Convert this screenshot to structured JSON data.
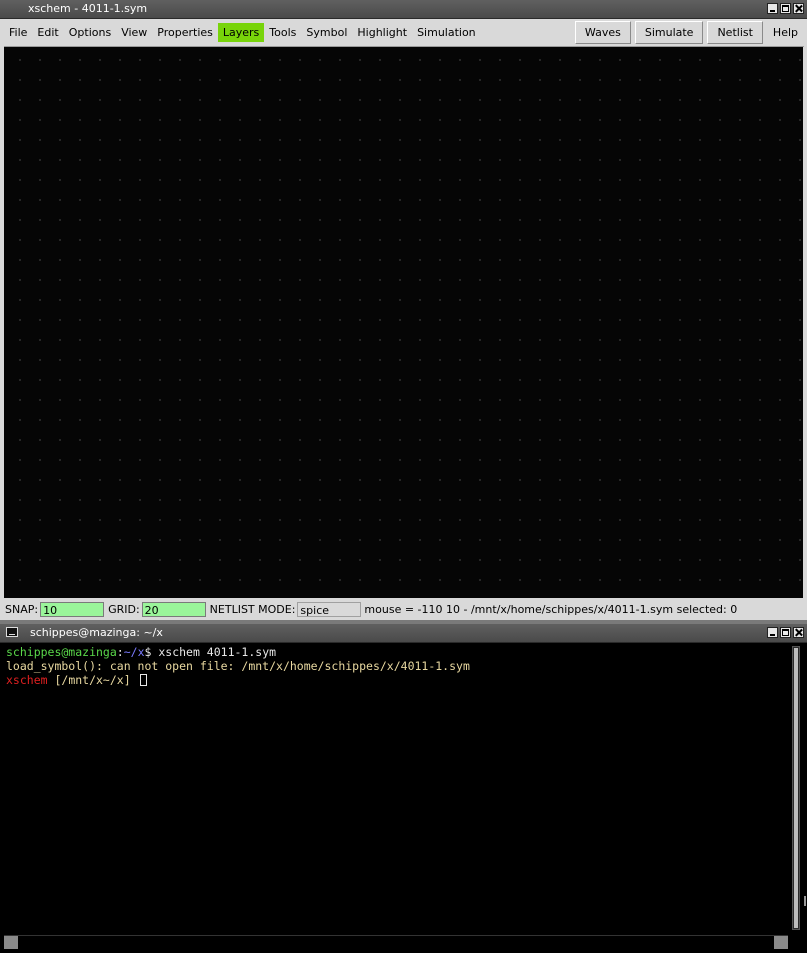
{
  "xschem": {
    "window_title": "xschem - 4011-1.sym",
    "menu": [
      "File",
      "Edit",
      "Options",
      "View",
      "Properties",
      "Layers",
      "Tools",
      "Symbol",
      "Highlight",
      "Simulation"
    ],
    "active_menu": "Layers",
    "toolbar": {
      "waves": "Waves",
      "simulate": "Simulate",
      "netlist": "Netlist",
      "help": "Help"
    },
    "status": {
      "snap_label": "SNAP:",
      "snap_value": "10",
      "grid_label": "GRID:",
      "grid_value": "20",
      "netlist_mode_label": "NETLIST MODE:",
      "netlist_mode_value": "spice",
      "mouse_info": "mouse = -110 10 - /mnt/x/home/schippes/x/4011-1.sym  selected: 0"
    },
    "colors": {
      "active_menu_bg": "#78d40a",
      "status_field_bg": "#9af59a",
      "canvas_bg": "#050505"
    }
  },
  "terminal": {
    "window_title": "schippes@mazinga: ~/x",
    "lines": {
      "l1_user": "schippes@mazinga",
      "l1_sep": ":",
      "l1_path": "~/x",
      "l1_cmd": "$ xschem 4011-1.sym",
      "l2": "load_symbol(): can not open file: /mnt/x/home/schippes/x/4011-1.sym",
      "l3_prog": "xschem",
      "l3_prompt": " [/mnt/x~/x] "
    }
  }
}
